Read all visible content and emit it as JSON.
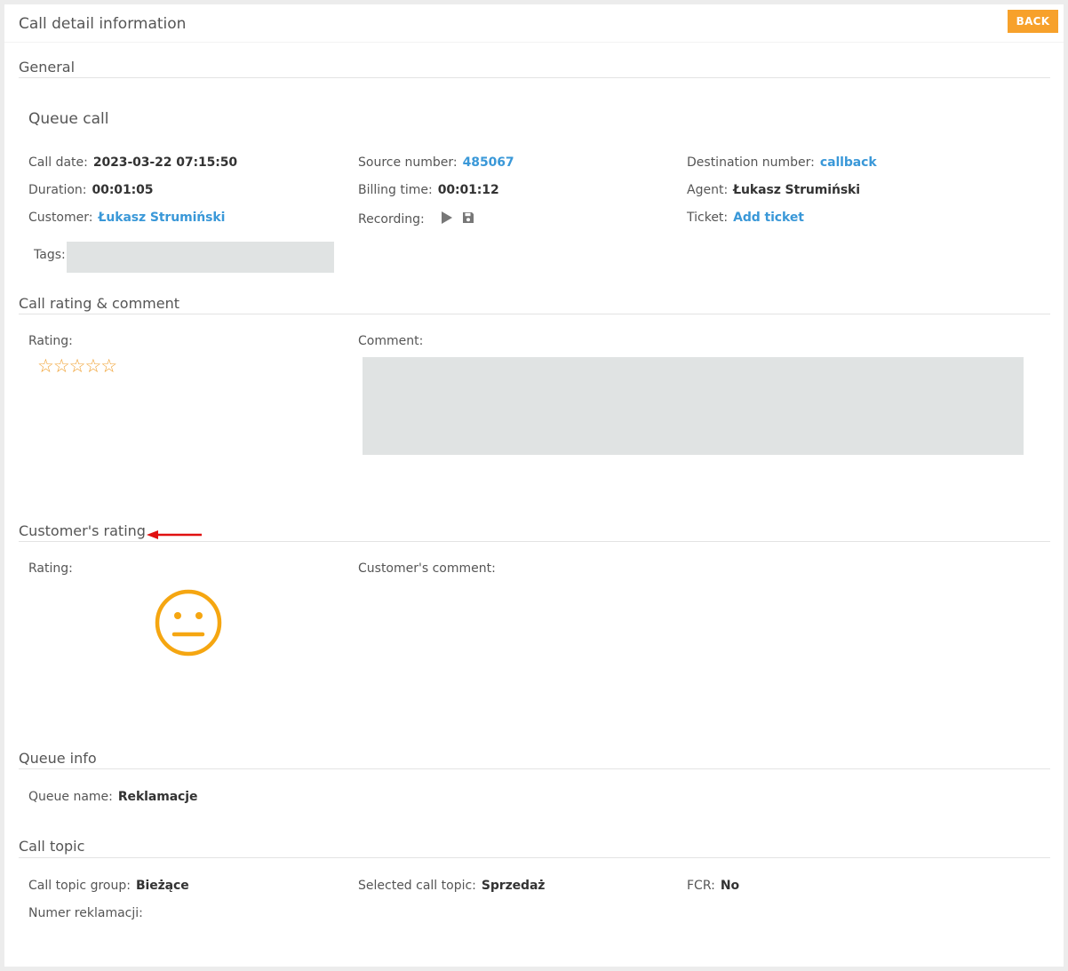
{
  "header": {
    "title": "Call detail information",
    "back_label": "BACK"
  },
  "general": {
    "section_title": "General",
    "call_type": "Queue call",
    "call_date": {
      "label": "Call date:",
      "value": "2023-03-22 07:15:50"
    },
    "source_number": {
      "label": "Source number:",
      "value": "485067"
    },
    "destination_number": {
      "label": "Destination number:",
      "value": "callback"
    },
    "duration": {
      "label": "Duration:",
      "value": "00:01:05"
    },
    "billing_time": {
      "label": "Billing time:",
      "value": "00:01:12"
    },
    "agent": {
      "label": "Agent:",
      "value": "Łukasz Strumiński"
    },
    "customer": {
      "label": "Customer:",
      "value": "Łukasz Strumiński"
    },
    "recording": {
      "label": "Recording:",
      "icons": [
        "play-icon",
        "save-icon"
      ]
    },
    "ticket": {
      "label": "Ticket:",
      "value": "Add ticket"
    },
    "tags": {
      "label": "Tags:",
      "value": ""
    }
  },
  "call_rating": {
    "section_title": "Call rating & comment",
    "rating_label": "Rating:",
    "stars": "☆☆☆☆☆",
    "rating_value": 0,
    "rating_max": 5,
    "comment_label": "Comment:",
    "comment_value": ""
  },
  "customer_rating": {
    "section_title": "Customer's rating",
    "rating_label": "Rating:",
    "rating_icon": "neutral-face-icon",
    "comment_label": "Customer's comment:",
    "comment_value": ""
  },
  "queue_info": {
    "section_title": "Queue info",
    "queue_name": {
      "label": "Queue name:",
      "value": "Reklamacje"
    }
  },
  "call_topic": {
    "section_title": "Call topic",
    "topic_group": {
      "label": "Call topic group:",
      "value": "Bieżące"
    },
    "selected_topic": {
      "label": "Selected call topic:",
      "value": "Sprzedaż"
    },
    "fcr": {
      "label": "FCR:",
      "value": "No"
    },
    "numer_reklamacji": {
      "label": "Numer reklamacji:",
      "value": ""
    }
  },
  "colors": {
    "accent": "#f7a12b",
    "link": "#3a98d8",
    "arrow": "#e01010",
    "smiley": "#f5a611",
    "stars": "#f0a030"
  }
}
